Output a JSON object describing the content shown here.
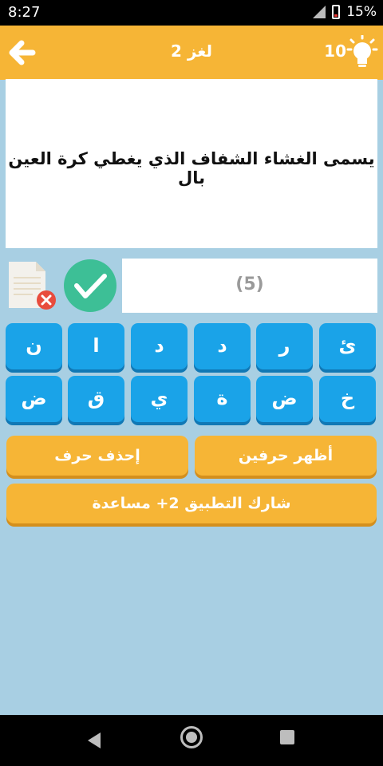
{
  "status_bar": {
    "time": "8:27",
    "battery": "15%"
  },
  "header": {
    "title": "لغز 2",
    "hints_count": "10"
  },
  "question": {
    "text": "يسمى الغشاء الشفاف الذي يغطي كرة العين بال"
  },
  "answer": {
    "length_label": "(5)"
  },
  "letters": {
    "row1": [
      "ئ",
      "ر",
      "د",
      "د",
      "ا",
      "ن"
    ],
    "row2": [
      "خ",
      "ض",
      "ة",
      "ي",
      "ق",
      "ض"
    ]
  },
  "actions": {
    "reveal_two": "أظهر حرفين",
    "remove_letter": "إحذف حرف",
    "share": "شارك التطبيق 2+ مساعدة"
  },
  "colors": {
    "topbar": "#f6b536",
    "background": "#a8cfe3",
    "letter_key": "#1aa3e8",
    "check": "#3dbf96"
  }
}
